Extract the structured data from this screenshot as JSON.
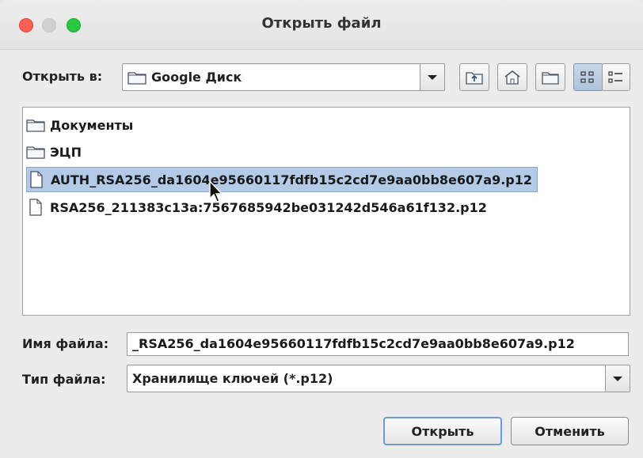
{
  "window": {
    "title": "Открыть файл"
  },
  "look_in": {
    "label": "Открыть в:",
    "value": "Google Диск"
  },
  "toolbar": {
    "icons": [
      "up-folder-icon",
      "home-icon",
      "new-folder-icon",
      "list-view-icon",
      "details-view-icon"
    ]
  },
  "files": [
    {
      "name": "Документы",
      "type": "folder"
    },
    {
      "name": "ЭЦП",
      "type": "folder"
    },
    {
      "name": "AUTH_RSA256_da1604e95660117fdfb15c2cd7e9aa0bb8e607a9.p12",
      "type": "file",
      "selected": true
    },
    {
      "name": "RSA256_211383c13a:7567685942be031242d546a61f132.p12",
      "type": "file"
    }
  ],
  "filename": {
    "label": "Имя файла:",
    "value": "_RSA256_da1604e95660117fdfb15c2cd7e9aa0bb8e607a9.p12"
  },
  "filetype": {
    "label": "Тип файла:",
    "value": "Хранилище ключей (*.p12)"
  },
  "buttons": {
    "open": "Открыть",
    "cancel": "Отменить"
  },
  "colors": {
    "selection": "#b4cbe8",
    "close": "#fe5f57",
    "zoom": "#28c840"
  }
}
